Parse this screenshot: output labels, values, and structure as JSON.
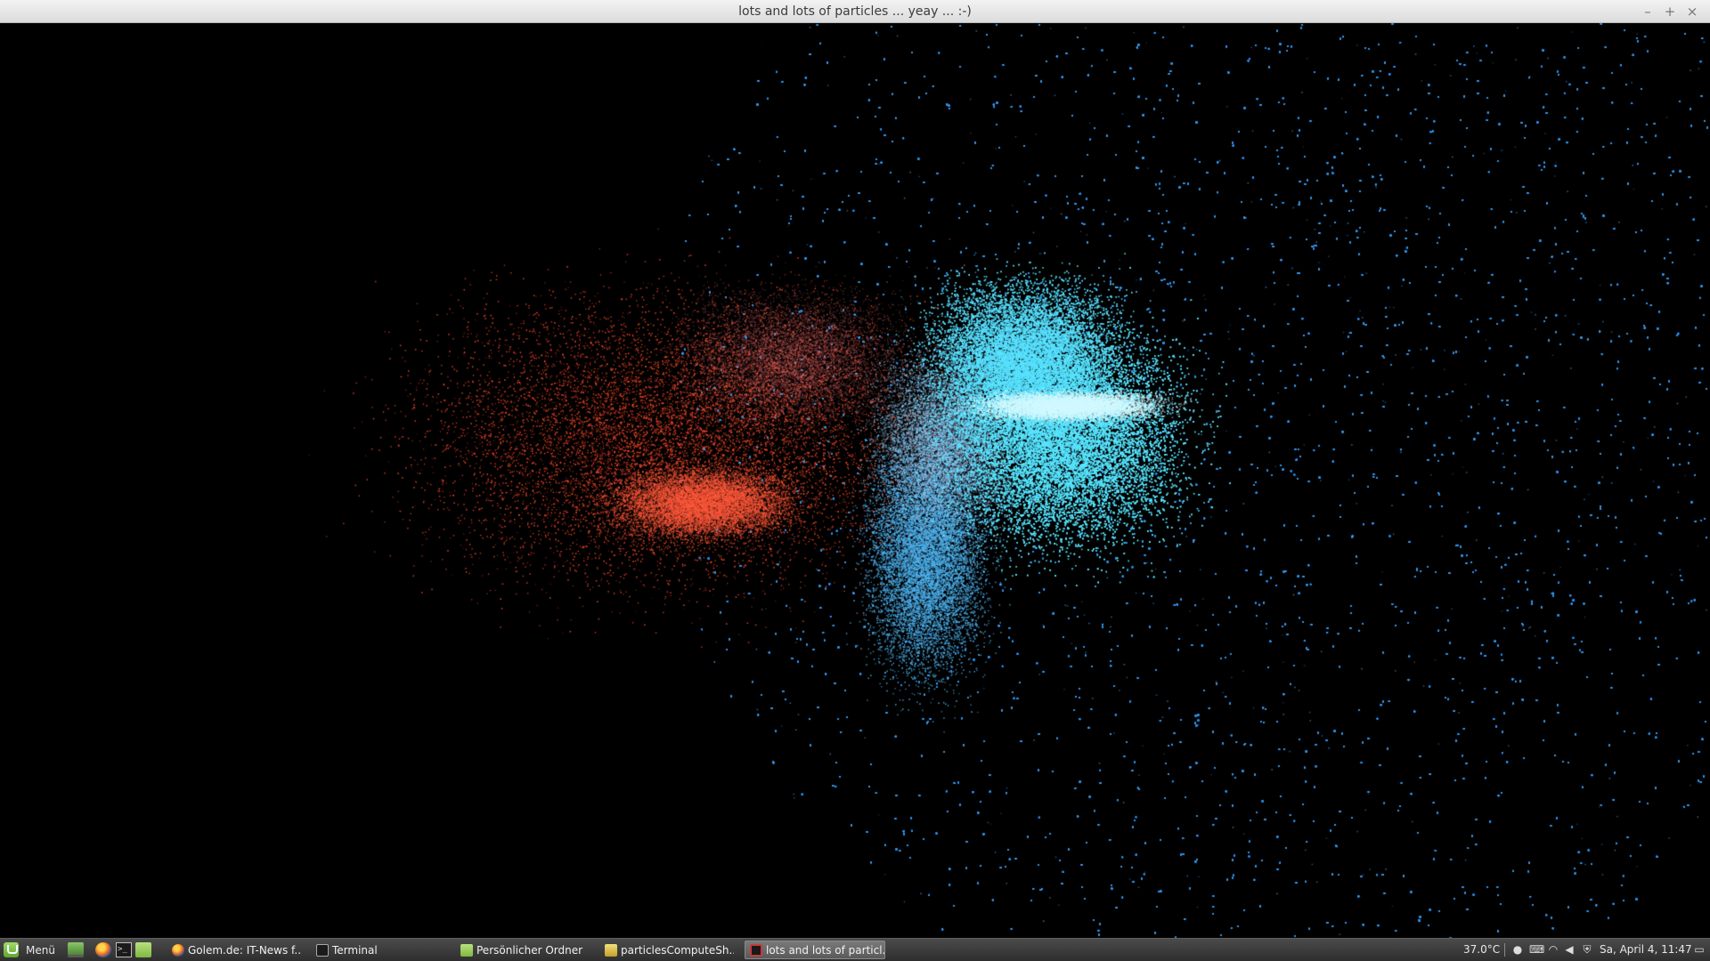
{
  "window": {
    "title": "lots and lots of particles ... yeay ... :-)",
    "controls": {
      "minimize": "–",
      "maximize": "+",
      "close": "×"
    }
  },
  "scene": {
    "background": "#000000",
    "cool_color": "#3aa8ff",
    "core_color": "#5fe6ff",
    "warm_color": "#ff5a2e"
  },
  "taskbar": {
    "menu_label": "Menü",
    "launchers": [
      "desktop-icon",
      "firefox-icon",
      "terminal-icon",
      "files-icon"
    ],
    "terminal_glyph": ">_",
    "tasks": [
      {
        "label": "Golem.de: IT-News f...",
        "icon": "firefox-icon",
        "active": false
      },
      {
        "label": "Terminal",
        "icon": "terminal-icon",
        "active": false
      },
      {
        "label": "Persönlicher Ordner",
        "icon": "folder-icon",
        "active": false
      },
      {
        "label": "particlesComputeSh...",
        "icon": "text-editor-icon",
        "active": false
      },
      {
        "label": "lots and lots of particl...",
        "icon": "opengl-window-icon",
        "active": true
      }
    ],
    "tray": {
      "temperature": "37.0°C",
      "icons": [
        "user-icon",
        "keyboard-icon",
        "wifi-icon",
        "volume-icon",
        "shield-icon",
        "show-desktop-icon"
      ],
      "clock": "Sa, April  4, 11:47"
    }
  }
}
